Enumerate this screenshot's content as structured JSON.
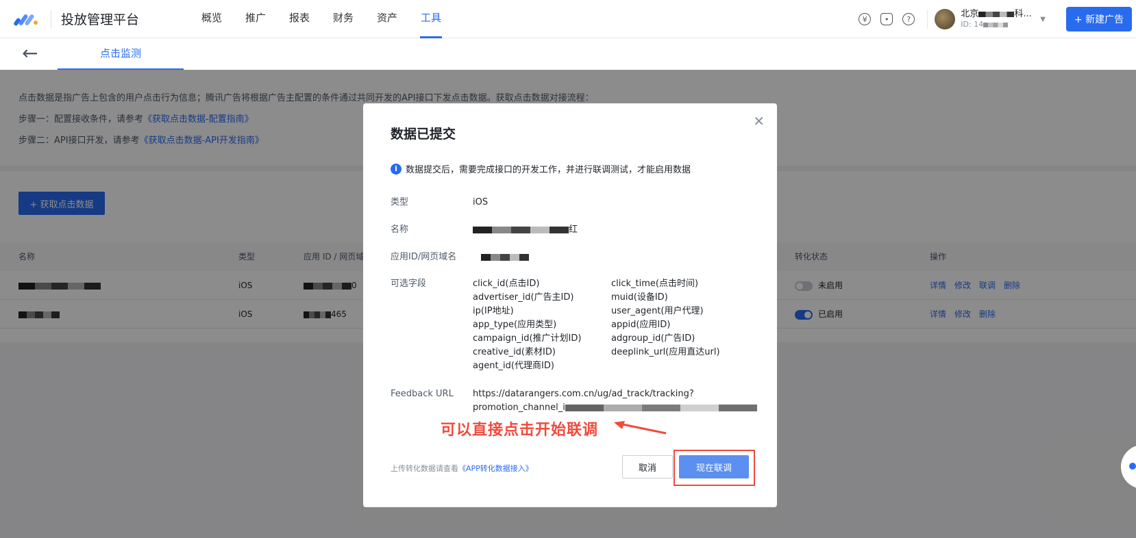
{
  "header": {
    "app_title": "投放管理平台",
    "nav": [
      "概览",
      "推广",
      "报表",
      "财务",
      "资产",
      "工具"
    ],
    "active_nav": "工具",
    "icons": [
      "yuan-icon",
      "bell-icon",
      "help-icon"
    ],
    "account_name": "北京",
    "account_name_suffix": "科...",
    "account_id": "ID: 14",
    "new_ad_label": "+ 新建广告"
  },
  "subheader": {
    "back_icon": "arrow-left-icon",
    "tab_label": "点击监测"
  },
  "intro": {
    "line1": "点击数据是指广告上包含的用户点击行为信息；腾讯广告将根据广告主配置的条件通过共同开发的API接口下发点击数据。获取点击数据对接流程：",
    "step1_prefix": "步骤一：配置接收条件，请参考",
    "step1_link": "《获取点击数据-配置指南》",
    "step2_prefix": "步骤二：API接口开发，请参考",
    "step2_link": "《获取点击数据-API开发指南》"
  },
  "list": {
    "get_button": "+ 获取点击数据",
    "columns": [
      "名称",
      "类型",
      "应用 ID / 网页域",
      "转化状态",
      "操作"
    ],
    "rows": [
      {
        "type": "iOS",
        "app_id_suffix": "0",
        "status": "未启用",
        "enabled": false,
        "ops": [
          "详情",
          "修改",
          "联调",
          "删除"
        ]
      },
      {
        "type": "iOS",
        "app_id_suffix": "465",
        "status": "已启用",
        "enabled": true,
        "ops": [
          "详情",
          "修改",
          "删除"
        ]
      }
    ]
  },
  "modal": {
    "title": "数据已提交",
    "notice": "数据提交后，需要完成接口的开发工作，并进行联调测试，才能启用数据",
    "type_label": "类型",
    "type_value": "iOS",
    "name_label": "名称",
    "name_value_tail": "红",
    "appid_label": "应用ID/网页域名",
    "fields_label": "可选字段",
    "fields": [
      "click_id(点击ID)",
      "click_time(点击时间)",
      "advertiser_id(广告主ID)",
      "muid(设备ID)",
      "ip(IP地址)",
      "user_agent(用户代理)",
      "app_type(应用类型)",
      "appid(应用ID)",
      "campaign_id(推广计划ID)",
      "adgroup_id(广告ID)",
      "creative_id(素材ID)",
      "deeplink_url(应用直达url)",
      "agent_id(代理商ID)"
    ],
    "feedback_label": "Feedback URL",
    "feedback_line1": "https://datarangers.com.cn/ug/ad_track/tracking?",
    "feedback_line2": "promotion_channel_i",
    "annotation": "可以直接点击开始联调",
    "foot_prefix": "上传转化数据请查看",
    "foot_link": "《APP转化数据接入》",
    "cancel_label": "取消",
    "go_label": "现在联调"
  },
  "colors": {
    "primary": "#296bef",
    "annotation": "#f04a3c"
  }
}
